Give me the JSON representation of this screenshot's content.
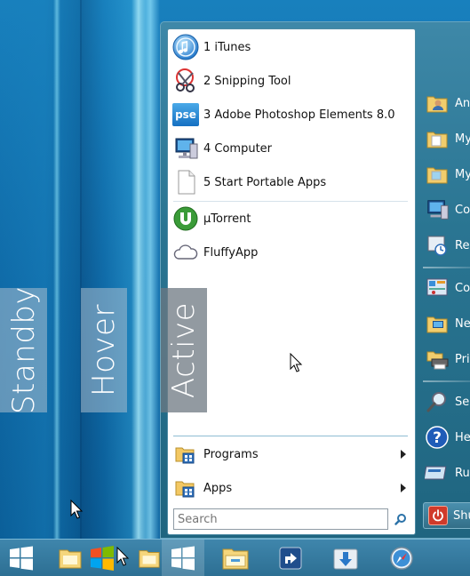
{
  "state_labels": {
    "standby": "Standby",
    "hover": "Hover",
    "active": "Active"
  },
  "start_menu": {
    "pinned": [
      {
        "label": "1 iTunes",
        "icon": "itunes-icon"
      },
      {
        "label": "2 Snipping Tool",
        "icon": "snipping-tool-icon"
      },
      {
        "label": "3 Adobe Photoshop Elements 8.0",
        "icon": "photoshop-elements-icon",
        "icon_text": "pse"
      },
      {
        "label": "4 Computer",
        "icon": "computer-icon"
      },
      {
        "label": "5 Start Portable Apps",
        "icon": "document-icon"
      }
    ],
    "recent": [
      {
        "label": "µTorrent",
        "icon": "utorrent-icon"
      },
      {
        "label": "FluffyApp",
        "icon": "cloud-icon"
      }
    ],
    "programs_label": "Programs",
    "apps_label": "Apps",
    "search_placeholder": "Search"
  },
  "right_pane": {
    "items": [
      {
        "label": "Andy",
        "icon": "user-folder-icon"
      },
      {
        "label": "My Documents",
        "icon": "folder-icon"
      },
      {
        "label": "My Pictures",
        "icon": "folder-icon"
      },
      {
        "label": "Computer",
        "icon": "computer-icon"
      },
      {
        "label": "Recent Items",
        "icon": "recent-items-icon"
      },
      {
        "label": "Control Panel",
        "icon": "control-panel-icon"
      },
      {
        "label": "Network",
        "icon": "network-icon"
      },
      {
        "label": "Printers",
        "icon": "printer-icon"
      },
      {
        "label": "Search",
        "icon": "search-icon"
      },
      {
        "label": "Help and Support",
        "icon": "help-icon"
      },
      {
        "label": "Run...",
        "icon": "run-icon"
      }
    ],
    "shutdown_label": "Shut Down"
  },
  "colors": {
    "taskbar": "#2d6f93",
    "start_frame": "#2a7592",
    "windows_logo": "#ffffff",
    "shutdown_red": "#d03a2a"
  }
}
